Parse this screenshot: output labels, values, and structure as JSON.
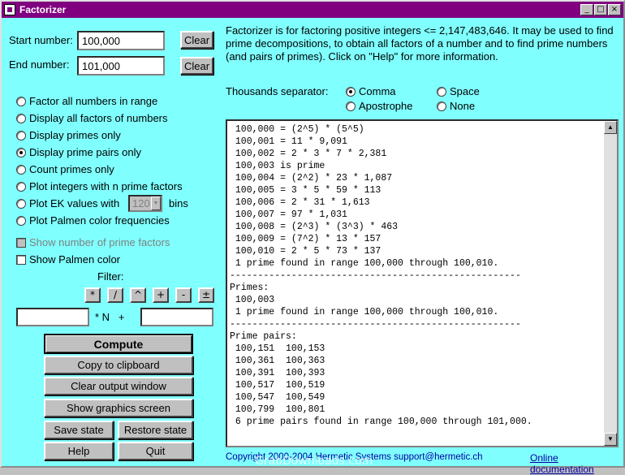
{
  "window": {
    "title": "Factorizer",
    "controls": [
      "_",
      "□",
      "×"
    ]
  },
  "inputs": {
    "start_label": "Start number:",
    "start_value": "100,000",
    "end_label": "End number:",
    "end_value": "101,000",
    "clear_label": "Clear"
  },
  "description": "Factorizer is for factoring positive integers <= 2,147,483,646.  It may be used to find prime decompositions, to obtain all factors of a number and to find prime numbers (and pairs of primes).  Click on \"Help\" for more information.",
  "separator": {
    "label": "Thousands separator:",
    "options": [
      {
        "label": "Comma",
        "selected": true
      },
      {
        "label": "Space",
        "selected": false
      },
      {
        "label": "Apostrophe",
        "selected": false
      },
      {
        "label": "None",
        "selected": false
      }
    ]
  },
  "modes": [
    {
      "label": "Factor all numbers in range",
      "selected": false
    },
    {
      "label": "Display all factors of numbers",
      "selected": false
    },
    {
      "label": "Display primes only",
      "selected": false
    },
    {
      "label": "Display prime pairs only",
      "selected": true
    },
    {
      "label": "Count primes only",
      "selected": false
    },
    {
      "label": "Plot integers with n  prime factors",
      "selected": false
    },
    {
      "label": "Plot EK values with",
      "selected": false
    },
    {
      "label": "Plot Palmen color frequencies",
      "selected": false
    }
  ],
  "ek_bins": {
    "value": "120",
    "suffix": "bins"
  },
  "checks": [
    {
      "label": "Show number of prime factors",
      "checked": false,
      "disabled": true
    },
    {
      "label": "Show Palmen color",
      "checked": false,
      "disabled": false
    }
  ],
  "filter": {
    "label": "Filter:",
    "ops": [
      "*",
      "/",
      "^",
      "+",
      "-",
      "±"
    ],
    "left_value": "",
    "mid_label": "* N   +",
    "right_value": ""
  },
  "buttons": {
    "compute": "Compute",
    "copy": "Copy to clipboard",
    "clear_output": "Clear output window",
    "graphics": "Show graphics screen",
    "save": "Save state",
    "restore": "Restore state",
    "help": "Help",
    "quit": "Quit"
  },
  "output_lines": [
    " 100,000 = (2^5) * (5^5)",
    " 100,001 = 11 * 9,091",
    " 100,002 = 2 * 3 * 7 * 2,381",
    " 100,003 is prime",
    " 100,004 = (2^2) * 23 * 1,087",
    " 100,005 = 3 * 5 * 59 * 113",
    " 100,006 = 2 * 31 * 1,613",
    " 100,007 = 97 * 1,031",
    " 100,008 = (2^3) * (3^3) * 463",
    " 100,009 = (7^2) * 13 * 157",
    " 100,010 = 2 * 5 * 73 * 137",
    " 1 prime found in range 100,000 through 100,010.",
    "----------------------------------------------------",
    "Primes:",
    " 100,003",
    " 1 prime found in range 100,000 through 100,010.",
    "----------------------------------------------------",
    "Prime pairs:",
    " 100,151  100,153",
    " 100,361  100,363",
    " 100,391  100,393",
    " 100,517  100,519",
    " 100,547  100,549",
    " 100,799  100,801",
    " 6 prime pairs found in range 100,000 through 101,000."
  ],
  "footer": {
    "copyright": "Copyright 2000-2004  Hermetic Systems  support@hermetic.ch",
    "doc_link": "Online documentation",
    "watermark": "GrabDownloads.com"
  }
}
